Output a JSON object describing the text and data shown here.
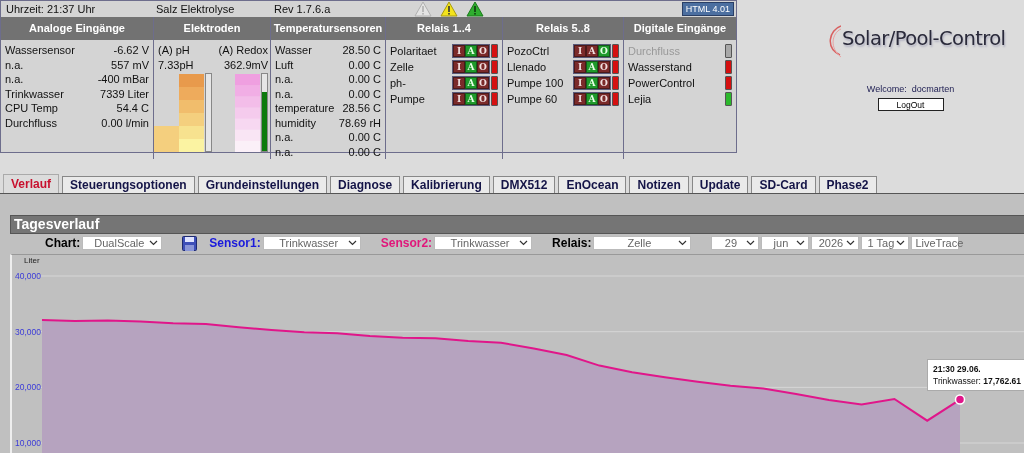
{
  "status_line": {
    "time": "Uhrzeit: 21:37 Uhr",
    "mode": "Salz Elektrolyse",
    "revision": "Rev 1.7.6.a",
    "badge": "HTML 4.01"
  },
  "analog_inputs": {
    "heading": "Analoge Eingänge",
    "rows": [
      {
        "label": "Wassersensor",
        "value": "-6.62 V"
      },
      {
        "label": "n.a.",
        "value": "557 mV"
      },
      {
        "label": "n.a.",
        "value": "-400 mBar"
      },
      {
        "label": "Trinkwasser",
        "value": "7339 Liter"
      },
      {
        "label": "CPU Temp",
        "value": "54.4 C"
      },
      {
        "label": "Durchfluss",
        "value": "0.00 l/min"
      }
    ]
  },
  "electrodes": {
    "heading": "Elektroden",
    "sensors": [
      {
        "kind": "ph",
        "name": "(A) pH",
        "reading": "7.33pH",
        "level": 0
      },
      {
        "kind": "redox",
        "name": "(A) Redox",
        "reading": "362.9mV",
        "level": 0.77
      }
    ]
  },
  "temperature_sensors": {
    "heading": "Temperatursensoren",
    "rows": [
      {
        "label": "Wasser",
        "value": "28.50 C"
      },
      {
        "label": "Luft",
        "value": "0.00 C"
      },
      {
        "label": "n.a.",
        "value": "0.00 C"
      },
      {
        "label": "n.a.",
        "value": "0.00 C"
      },
      {
        "label": "temperature",
        "value": "28.56 C"
      },
      {
        "label": "humidity",
        "value": "78.69 rH"
      },
      {
        "label": "n.a.",
        "value": "0.00 C"
      },
      {
        "label": "n.a.",
        "value": "0.00 C"
      }
    ]
  },
  "relay_groups": [
    {
      "heading": "Relais 1..4",
      "relays": [
        {
          "name": "Polaritaet",
          "on": false,
          "modes": [
            {
              "label": "I",
              "selected": false
            },
            {
              "label": "A",
              "selected": true
            },
            {
              "label": "O",
              "selected": false
            }
          ]
        },
        {
          "name": "Zelle",
          "on": false,
          "modes": [
            {
              "label": "I",
              "selected": false
            },
            {
              "label": "A",
              "selected": true
            },
            {
              "label": "O",
              "selected": false
            }
          ]
        },
        {
          "name": "ph-",
          "on": false,
          "modes": [
            {
              "label": "I",
              "selected": false
            },
            {
              "label": "A",
              "selected": true
            },
            {
              "label": "O",
              "selected": false
            }
          ]
        },
        {
          "name": "Pumpe",
          "on": false,
          "modes": [
            {
              "label": "I",
              "selected": false
            },
            {
              "label": "A",
              "selected": true
            },
            {
              "label": "O",
              "selected": false
            }
          ]
        }
      ]
    },
    {
      "heading": "Relais 5..8",
      "relays": [
        {
          "name": "PozoCtrl",
          "on": false,
          "modes": [
            {
              "label": "I",
              "selected": false
            },
            {
              "label": "A",
              "selected": false
            },
            {
              "label": "O",
              "selected": true
            }
          ]
        },
        {
          "name": "Llenado",
          "on": false,
          "modes": [
            {
              "label": "I",
              "selected": false
            },
            {
              "label": "A",
              "selected": true
            },
            {
              "label": "O",
              "selected": false
            }
          ]
        },
        {
          "name": "Pumpe 100",
          "on": false,
          "modes": [
            {
              "label": "I",
              "selected": false
            },
            {
              "label": "A",
              "selected": true
            },
            {
              "label": "O",
              "selected": false
            }
          ]
        },
        {
          "name": "Pumpe 60",
          "on": false,
          "modes": [
            {
              "label": "I",
              "selected": false
            },
            {
              "label": "A",
              "selected": true
            },
            {
              "label": "O",
              "selected": false
            }
          ]
        }
      ]
    }
  ],
  "digital_inputs": {
    "heading": "Digitale Eingänge",
    "rows": [
      {
        "label": "Durchfluss",
        "disabled": true,
        "on": false
      },
      {
        "label": "Wasserstand",
        "disabled": false,
        "on": false
      },
      {
        "label": "PowerControl",
        "disabled": false,
        "on": false
      },
      {
        "label": "Lejia",
        "disabled": false,
        "on": true
      }
    ]
  },
  "logo": {
    "text": "Solar/Pool-Control"
  },
  "user": {
    "welcome": "Welcome:  docmarten",
    "logout": "LogOut"
  },
  "tabs": [
    {
      "label": "Verlauf",
      "selected": true
    },
    {
      "label": "Steuerungsoptionen",
      "selected": false
    },
    {
      "label": "Grundeinstellungen",
      "selected": false
    },
    {
      "label": "Diagnose",
      "selected": false
    },
    {
      "label": "Kalibrierung",
      "selected": false
    },
    {
      "label": "DMX512",
      "selected": false
    },
    {
      "label": "EnOcean",
      "selected": false
    },
    {
      "label": "Notizen",
      "selected": false
    },
    {
      "label": "Update",
      "selected": false
    },
    {
      "label": "SD-Card",
      "selected": false
    },
    {
      "label": "Phase2",
      "selected": false
    }
  ],
  "section": {
    "title": "Tagesverlauf"
  },
  "controls": [
    {
      "kind": "select",
      "label": "Chart:",
      "value": "DualScale",
      "color": "#000000"
    },
    {
      "kind": "save"
    },
    {
      "kind": "select",
      "label": "Sensor1:",
      "value": "Trinkwasser",
      "color": "#1a1adc"
    },
    {
      "kind": "select",
      "label": "Sensor2:",
      "value": "Trinkwasser",
      "color": "#e0167a"
    },
    {
      "kind": "select",
      "label": "Relais:",
      "value": "Zelle",
      "color": "#000000"
    },
    {
      "kind": "select",
      "value": "29"
    },
    {
      "kind": "select",
      "value": "jun"
    },
    {
      "kind": "select",
      "value": "2026"
    },
    {
      "kind": "select",
      "value": "1 Tag"
    },
    {
      "kind": "select",
      "value": "LiveTrace"
    }
  ],
  "chart": {
    "tooltip": {
      "title": "21:30 29.06.",
      "text": "Trinkwasser: **17,762.61**"
    },
    "chart_data": {
      "type": "area",
      "ylabel": "Liter",
      "grid": true,
      "ylim": [
        10000,
        40000
      ],
      "yticks": [
        {
          "value": 10000,
          "label": "10,000"
        },
        {
          "value": 20000,
          "label": "20,000"
        },
        {
          "value": 30000,
          "label": "30,000"
        },
        {
          "value": 40000,
          "label": "40,000"
        }
      ],
      "series": [
        {
          "color": "#e0168a",
          "values": [
            32100,
            31900,
            32000,
            31800,
            31500,
            31400,
            30800,
            30300,
            29900,
            29700,
            29200,
            28900,
            28800,
            28300,
            28000,
            27000,
            25800,
            23900,
            22700,
            21800,
            21000,
            20300,
            19800,
            18800,
            17700,
            16900,
            17900,
            14000,
            17800
          ]
        }
      ]
    }
  }
}
